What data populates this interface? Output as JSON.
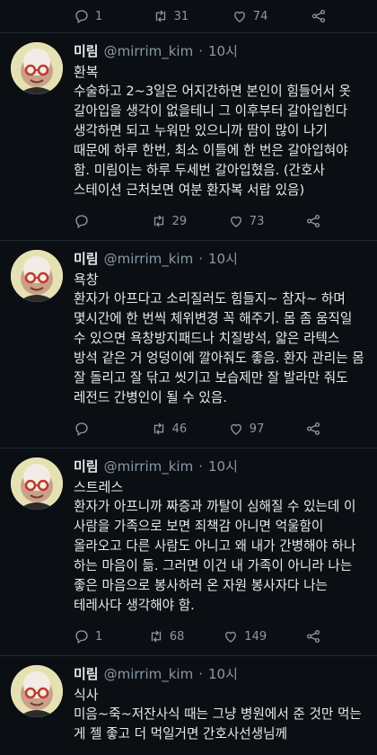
{
  "top_stats": {
    "replies": "1",
    "retweets": "31",
    "likes": "74"
  },
  "tweets": [
    {
      "name": "미림",
      "handle": "@mirrim_kim",
      "time": "10시",
      "title": "환복",
      "body": "수술하고 2~3일은 어지간하면 본인이 힘들어서 옷 갈아입을 생각이 없을테니 그 이후부터 갈아입힌다 생각하면 되고 누워만 있으니까 땀이 많이 나기 때문에 하루 한번, 최소 이틀에 한 번은 갈아입혀야 함. 미림이는 하루 두세번 갈아입혔음. (간호사 스테이션 근처보면 여분 환자복 서랍 있음)",
      "retweets": "29",
      "likes": "73"
    },
    {
      "name": "미림",
      "handle": "@mirrim_kim",
      "time": "10시",
      "title": "욕창",
      "body": "환자가 아프다고 소리질러도 힘들지~ 참자~ 하며 몇시간에 한 번씩 체위변경 꼭 해주기. 몸 좀 움직일 수 있으면 욕창방지패드나 치질방석, 얇은 라텍스 방석 같은 거 엉덩이에 깔아줘도 좋음. 환자 관리는 몸 잘 돌리고 잘 닦고 씻기고 보습제만 잘 발라만 줘도 레전드 간병인이 될 수 있음.",
      "retweets": "46",
      "likes": "97"
    },
    {
      "name": "미림",
      "handle": "@mirrim_kim",
      "time": "10시",
      "title": "스트레스",
      "body": "환자가 아프니까 짜증과 까탈이 심해질 수 있는데 이 사람을 가족으로 보면 죄책감 아니면 억울함이 올라오고 다른 사람도 아니고 왜 내가 간병해야 하나 하는 마음이 듦. 그러면 이건 내 가족이 아니라 나는 좋은 마음으로 봉사하러 온 자원 봉사자다 나는 테레사다 생각해야 함.",
      "replies": "1",
      "retweets": "68",
      "likes": "149"
    },
    {
      "name": "미림",
      "handle": "@mirrim_kim",
      "time": "10시",
      "title": "식사",
      "body": "미음~죽~저잔사식 때는 그냥 병원에서 준 것만 먹는 게 젤 좋고 더 먹일거면 간호사선생님께"
    }
  ],
  "colors": {
    "background": "#0b0f14",
    "text": "#e7e9ea",
    "muted": "#8b98a5",
    "divider": "#1f2a33"
  },
  "icons": [
    "reply-icon",
    "retweet-icon",
    "like-icon",
    "share-icon"
  ]
}
